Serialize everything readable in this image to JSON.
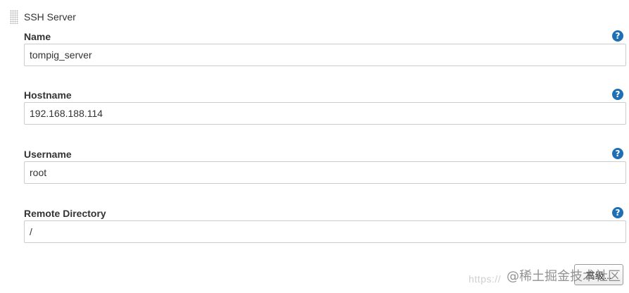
{
  "section": {
    "title": "SSH Server"
  },
  "fields": {
    "name": {
      "label": "Name",
      "value": "tompig_server"
    },
    "hostname": {
      "label": "Hostname",
      "value": "192.168.188.114"
    },
    "username": {
      "label": "Username",
      "value": "root"
    },
    "remote_directory": {
      "label": "Remote Directory",
      "value": "/"
    }
  },
  "help_icon": {
    "glyph": "?",
    "icon": "help-circle-icon",
    "color": "#1f6fb5"
  },
  "advanced_button": {
    "label": "高级..."
  },
  "watermark": {
    "url": "https://",
    "brand": "@稀土掘金技术社区"
  }
}
